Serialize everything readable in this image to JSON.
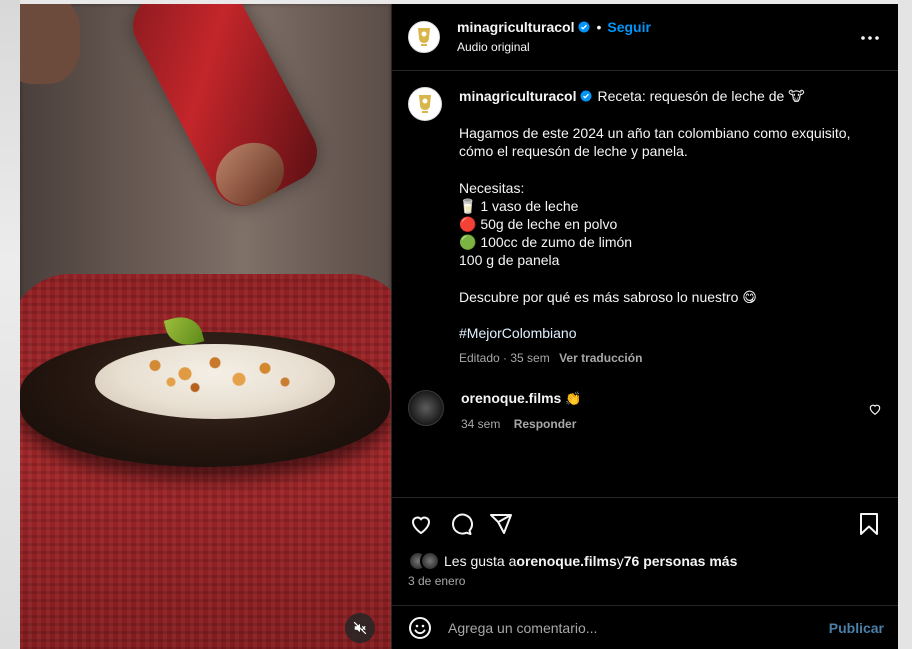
{
  "post": {
    "username": "minagriculturacol",
    "follow_label": "Seguir",
    "separator": "•",
    "audio": "Audio original",
    "more_icon": "more-horizontal-icon"
  },
  "caption": {
    "username": "minagriculturacol",
    "title": "Receta: requesón de leche de 🐮",
    "intro": "Hagamos de este 2024 un año tan colombiano como exquisito, cómo el requesón de leche y panela.",
    "needs_heading": "Necesitas:",
    "ingredients": [
      "🥛 1 vaso de leche",
      "🔴 50g de leche en polvo",
      "🟢 100cc de zumo de limón",
      "100 g de panela"
    ],
    "cta": "Descubre por qué es más sabroso lo nuestro 😋",
    "hashtag": "#MejorColombiano",
    "meta": "Editado · 35 sem",
    "translate_label": "Ver traducción"
  },
  "comments": [
    {
      "username": "orenoque.films",
      "text": "👏",
      "time": "34 sem",
      "reply_label": "Responder"
    }
  ],
  "likes": {
    "prefix": "Les gusta a ",
    "user": "orenoque.films",
    "middle": " y ",
    "others": "76 personas más"
  },
  "date": "3 de enero",
  "comment_box": {
    "placeholder": "Agrega un comentario...",
    "publish_label": "Publicar"
  },
  "icons": {
    "like": "heart-icon",
    "comment": "comment-icon",
    "share": "share-icon",
    "save": "bookmark-icon",
    "emoji": "emoji-icon",
    "mute": "muted-audio-icon"
  },
  "colors": {
    "accent": "#0095f6",
    "background": "#000000",
    "muted_text": "#a8a8a8"
  }
}
